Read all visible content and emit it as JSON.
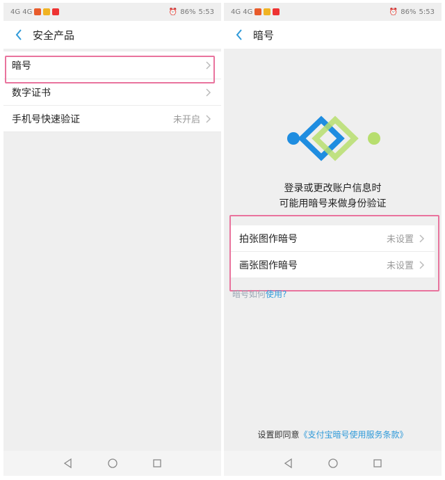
{
  "status": {
    "left_text": "4G 4G",
    "battery": "86%",
    "time": "5:53"
  },
  "left": {
    "title": "安全产品",
    "items": [
      {
        "label": "暗号",
        "value": ""
      },
      {
        "label": "数字证书",
        "value": ""
      },
      {
        "label": "手机号快速验证",
        "value": "未开启"
      }
    ]
  },
  "right": {
    "title": "暗号",
    "desc_line1": "登录或更改账户信息时",
    "desc_line2": "可能用暗号来做身份验证",
    "items": [
      {
        "label": "拍张图作暗号",
        "value": "未设置"
      },
      {
        "label": "画张图作暗号",
        "value": "未设置"
      }
    ],
    "how_a": "暗号如何",
    "how_b": "使用?",
    "agree_a": "设置即同意",
    "agree_b": "《支付宝暗号使用服务条款》"
  },
  "icons": {
    "back": "chevron-left-icon",
    "chevron": "chevron-right-icon",
    "nav_back": "triangle-back-icon",
    "nav_home": "circle-home-icon",
    "nav_recent": "square-recent-icon"
  },
  "colors": {
    "accent": "#2f9ad9",
    "highlight": "#e9739d",
    "logo_blue": "#1f8de0",
    "logo_green": "#b7de6e"
  }
}
